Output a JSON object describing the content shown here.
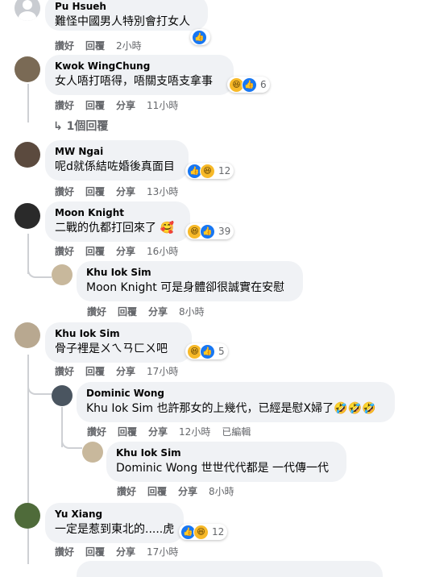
{
  "actions": {
    "like": "讚好",
    "reply": "回覆",
    "share": "分享"
  },
  "comments": [
    {
      "name": "Pu Hsueh",
      "text": "難怪中國男人特別會打女人",
      "time": "2小時",
      "reactions": {
        "types": [
          "like"
        ],
        "count": ""
      }
    },
    {
      "name": "Kwok WingChung",
      "text": "女人唔打唔得，唔關支唔支拿事",
      "time": "11小時",
      "reactions": {
        "types": [
          "haha",
          "like"
        ],
        "count": "6"
      }
    },
    {
      "name": "MW Ngai",
      "text": "呢d就係結咗婚後真面目",
      "time": "13小時",
      "reactions": {
        "types": [
          "like",
          "haha"
        ],
        "count": "12"
      }
    },
    {
      "name": "Moon Knight",
      "text": "二戰的仇都打回來了 🥰",
      "time": "16小時",
      "reactions": {
        "types": [
          "haha",
          "like"
        ],
        "count": "39"
      }
    },
    {
      "name": "Khu Iok Sim",
      "text": "Moon Knight 可是身體卻很誠實在安慰",
      "time": "8小時"
    },
    {
      "name": "Khu Iok Sim",
      "text": "骨子裡是ㄨㄟㄢㄈㄨ吧",
      "time": "17小時",
      "reactions": {
        "types": [
          "haha",
          "like"
        ],
        "count": "5"
      }
    },
    {
      "name": "Dominic Wong",
      "text": "Khu Iok Sim 也許那女的上幾代，已經是慰X婦了🤣🤣🤣",
      "time": "12小時",
      "edited": "已編輯"
    },
    {
      "name": "Khu Iok Sim",
      "text": "Dominic Wong 世世代代都是 一代傳一代",
      "time": "8小時"
    },
    {
      "name": "Yu Xiang",
      "text": "一定是惹到東北的.....虎",
      "time": "17小時",
      "reactions": {
        "types": [
          "like",
          "haha"
        ],
        "count": "12"
      }
    }
  ],
  "replies_link": "1個回覆",
  "icons": {
    "like": "thumbs-up-icon",
    "haha": "laughing-face-icon",
    "reply_arrow": "reply-arrow-icon"
  },
  "colors": {
    "like": "#1877f2",
    "haha": "#f7b928",
    "bubble": "#f0f2f5",
    "meta": "#65676b"
  }
}
